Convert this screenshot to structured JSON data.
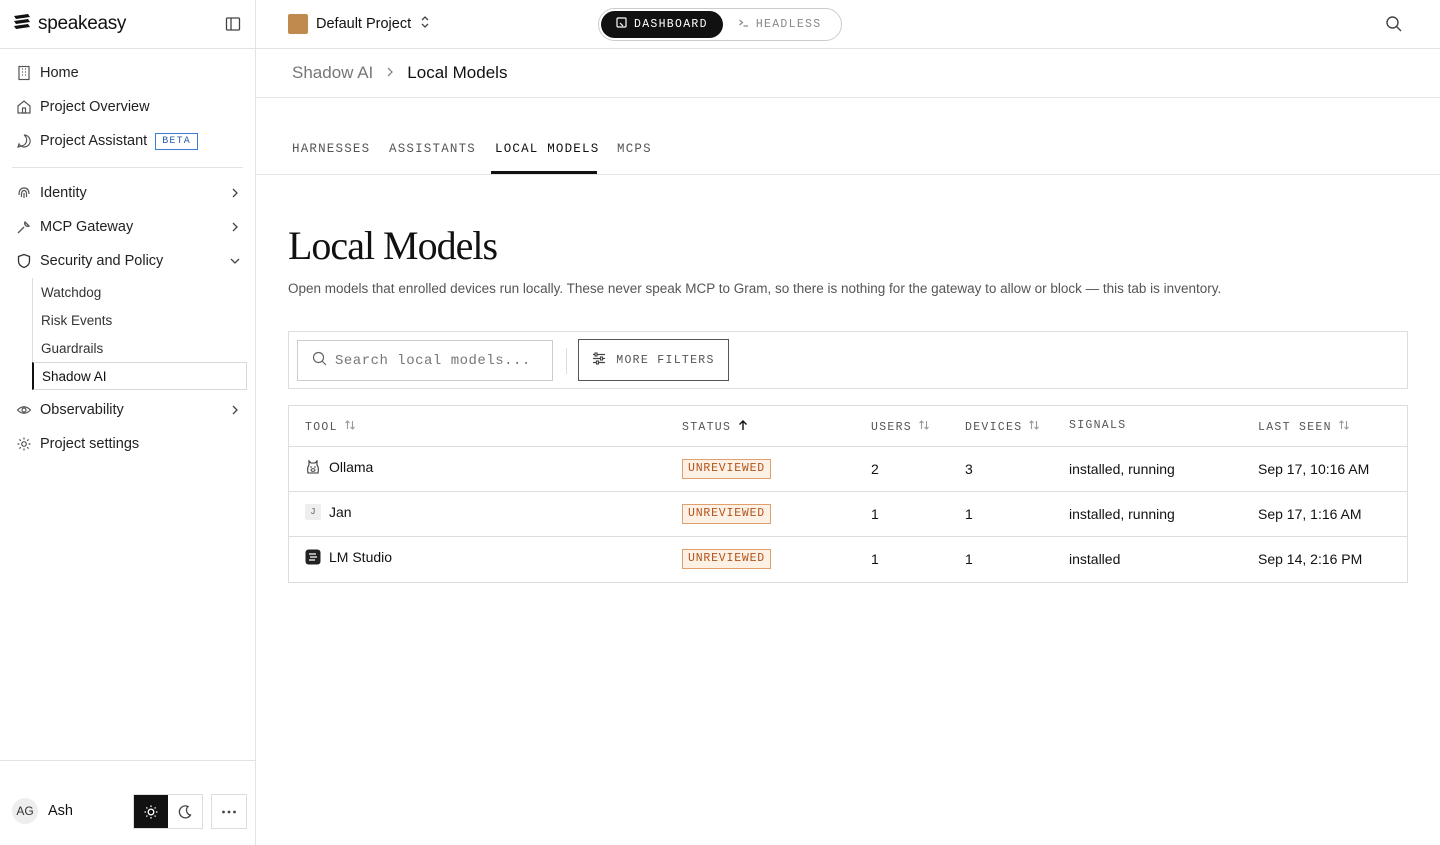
{
  "brand": {
    "name": "speakeasy"
  },
  "topbar": {
    "project_name": "Default Project",
    "project_color": "#c08a4f",
    "mode_dashboard": "DASHBOARD",
    "mode_headless": "HEADLESS"
  },
  "sidebar": {
    "items": [
      {
        "label": "Home"
      },
      {
        "label": "Project Overview"
      },
      {
        "label": "Project Assistant",
        "badge": "BETA"
      },
      {
        "label": "Identity"
      },
      {
        "label": "MCP Gateway"
      },
      {
        "label": "Security and Policy"
      },
      {
        "label": "Observability"
      },
      {
        "label": "Project settings"
      }
    ],
    "security_sub": [
      {
        "label": "Watchdog"
      },
      {
        "label": "Risk Events"
      },
      {
        "label": "Guardrails"
      },
      {
        "label": "Shadow AI"
      }
    ],
    "user": {
      "initials": "AG",
      "name": "Ash"
    }
  },
  "breadcrumb": {
    "parent": "Shadow AI",
    "current": "Local Models"
  },
  "tabs": [
    {
      "label": "HARNESSES"
    },
    {
      "label": "ASSISTANTS"
    },
    {
      "label": "LOCAL MODELS",
      "active": true
    },
    {
      "label": "MCPS"
    }
  ],
  "page": {
    "title": "Local Models",
    "description": "Open models that enrolled devices run locally. These never speak MCP to Gram, so there is nothing for the gateway to allow or block — this tab is inventory."
  },
  "filters": {
    "search_placeholder": "Search local models...",
    "more_filters": "MORE FILTERS"
  },
  "table": {
    "columns": [
      "TOOL",
      "STATUS",
      "USERS",
      "DEVICES",
      "SIGNALS",
      "LAST SEEN"
    ],
    "rows": [
      {
        "tool": "Ollama",
        "icon": "ollama-icon",
        "status": "UNREVIEWED",
        "users": "2",
        "devices": "3",
        "signals": "installed, running",
        "last_seen": "Sep 17, 10:16 AM"
      },
      {
        "tool": "Jan",
        "icon": "jan-icon",
        "icon_letter": "J",
        "status": "UNREVIEWED",
        "users": "1",
        "devices": "1",
        "signals": "installed, running",
        "last_seen": "Sep 17, 1:16 AM"
      },
      {
        "tool": "LM Studio",
        "icon": "lm-studio-icon",
        "status": "UNREVIEWED",
        "users": "1",
        "devices": "1",
        "signals": "installed",
        "last_seen": "Sep 14, 2:16 PM"
      }
    ]
  }
}
